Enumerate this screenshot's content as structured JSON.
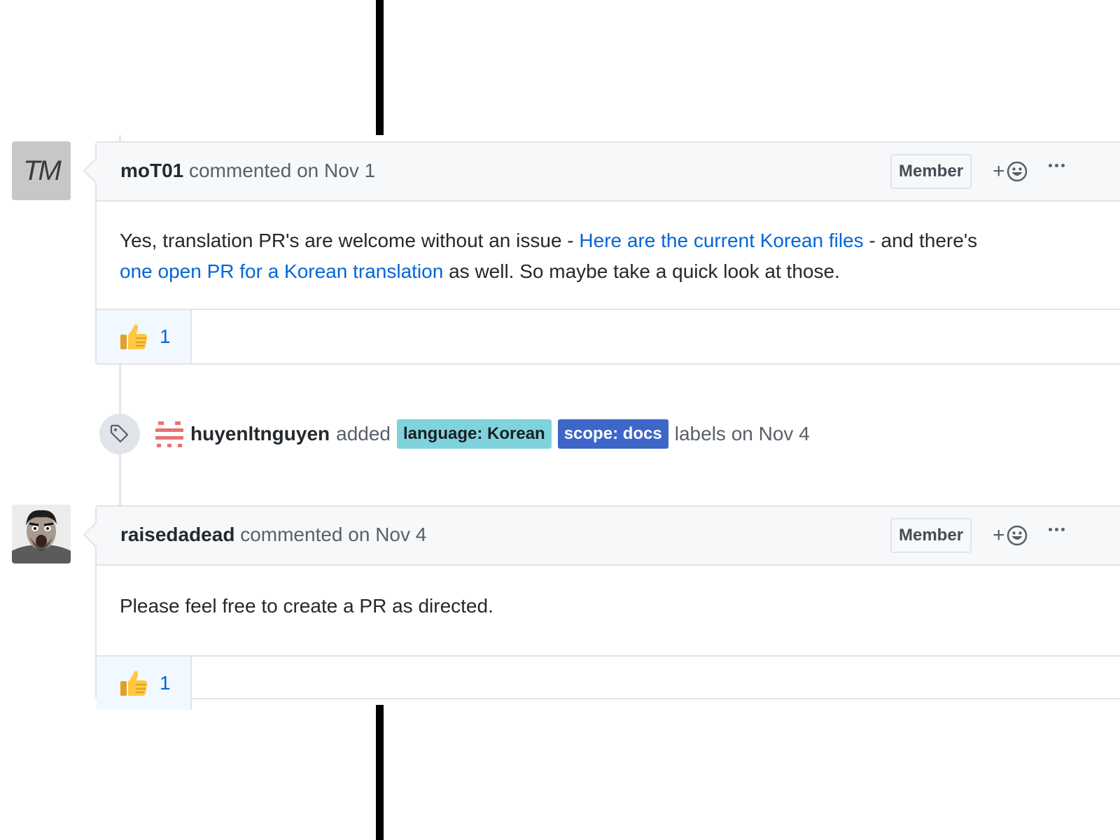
{
  "comments": [
    {
      "author": "moT01",
      "action": "commented on Nov 1",
      "badge": "Member",
      "avatar_text": "TM",
      "body": {
        "t1": "Yes, translation PR's are welcome without an issue - ",
        "link1": "Here are the current Korean files",
        "t2": " - and there's",
        "link2": "one open PR for a Korean translation",
        "t3": " as well. So maybe take a quick look at those."
      },
      "reaction": {
        "emoji": "👍",
        "count": "1"
      }
    },
    {
      "author": "raisedadead",
      "action": "commented on Nov 4",
      "badge": "Member",
      "body": {
        "t1": "Please feel free to create a PR as directed."
      },
      "reaction": {
        "emoji": "👍",
        "count": "1"
      }
    }
  ],
  "event": {
    "author": "huyenltnguyen",
    "verb": "added",
    "labels": [
      {
        "text": "language: Korean",
        "color": "#7fd3dc"
      },
      {
        "text": "scope: docs",
        "color": "#3d66c8"
      }
    ],
    "after": "labels on Nov 4"
  },
  "colors": {
    "link": "#0366d6",
    "border": "#e1e4e8",
    "header_bg": "#f6f8fa"
  }
}
